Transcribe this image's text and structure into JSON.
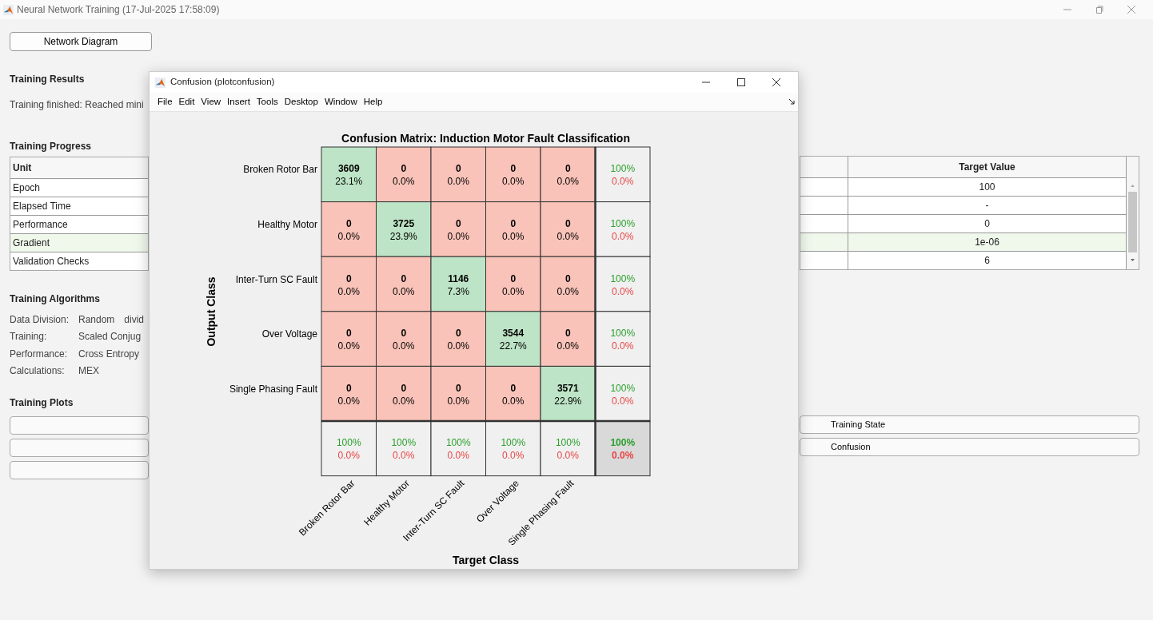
{
  "window": {
    "title": "Neural Network Training (17-Jul-2025 17:58:09)"
  },
  "network_diagram_button": {
    "label": "Network Diagram"
  },
  "training_results": {
    "heading": "Training Results",
    "message": "Training finished: Reached mini"
  },
  "training_progress": {
    "heading": "Training Progress",
    "columns": [
      "Unit",
      "Target Value"
    ],
    "rows": [
      {
        "unit": "Epoch",
        "target": "100",
        "highlighted": false
      },
      {
        "unit": "Elapsed Time",
        "target": "-",
        "highlighted": false
      },
      {
        "unit": "Performance",
        "target": "0",
        "highlighted": false
      },
      {
        "unit": "Gradient",
        "target": "1e-06",
        "highlighted": true
      },
      {
        "unit": "Validation Checks",
        "target": "6",
        "highlighted": false
      }
    ]
  },
  "training_algorithms": {
    "heading": "Training Algorithms",
    "items": [
      {
        "label": "Data Division:",
        "value": "Random",
        "extra": "divid"
      },
      {
        "label": "Training:",
        "value": "Scaled Conjug"
      },
      {
        "label": "Performance:",
        "value": "Cross Entropy"
      },
      {
        "label": "Calculations:",
        "value": "MEX"
      }
    ]
  },
  "training_plots": {
    "heading": "Training Plots",
    "buttons": [
      {
        "kind": "split",
        "label": "Training State"
      },
      {
        "kind": "split",
        "label": "Confusion"
      },
      {
        "kind": "left_only"
      }
    ]
  },
  "confusion_window": {
    "title": "Confusion (plotconfusion)",
    "menu": [
      "File",
      "Edit",
      "View",
      "Insert",
      "Tools",
      "Desktop",
      "Window",
      "Help"
    ],
    "plot": {
      "title": "Confusion Matrix: Induction Motor Fault Classification",
      "ylabel": "Output Class",
      "xlabel": "Target Class",
      "rows": [
        {
          "label": "Broken Rotor Bar",
          "cells": [
            {
              "kind": "correct",
              "count": "3609",
              "percent": "23.1%"
            },
            {
              "kind": "error",
              "count": "0",
              "percent": "0.0%"
            },
            {
              "kind": "error",
              "count": "0",
              "percent": "0.0%"
            },
            {
              "kind": "error",
              "count": "0",
              "percent": "0.0%"
            },
            {
              "kind": "error",
              "count": "0",
              "percent": "0.0%"
            }
          ],
          "summary": {
            "correct": "100%",
            "error": "0.0%"
          }
        },
        {
          "label": "Healthy Motor",
          "cells": [
            {
              "kind": "error",
              "count": "0",
              "percent": "0.0%"
            },
            {
              "kind": "correct",
              "count": "3725",
              "percent": "23.9%"
            },
            {
              "kind": "error",
              "count": "0",
              "percent": "0.0%"
            },
            {
              "kind": "error",
              "count": "0",
              "percent": "0.0%"
            },
            {
              "kind": "error",
              "count": "0",
              "percent": "0.0%"
            }
          ],
          "summary": {
            "correct": "100%",
            "error": "0.0%"
          }
        },
        {
          "label": "Inter-Turn SC Fault",
          "cells": [
            {
              "kind": "error",
              "count": "0",
              "percent": "0.0%"
            },
            {
              "kind": "error",
              "count": "0",
              "percent": "0.0%"
            },
            {
              "kind": "correct",
              "count": "1146",
              "percent": "7.3%"
            },
            {
              "kind": "error",
              "count": "0",
              "percent": "0.0%"
            },
            {
              "kind": "error",
              "count": "0",
              "percent": "0.0%"
            }
          ],
          "summary": {
            "correct": "100%",
            "error": "0.0%"
          }
        },
        {
          "label": "Over Voltage",
          "cells": [
            {
              "kind": "error",
              "count": "0",
              "percent": "0.0%"
            },
            {
              "kind": "error",
              "count": "0",
              "percent": "0.0%"
            },
            {
              "kind": "error",
              "count": "0",
              "percent": "0.0%"
            },
            {
              "kind": "correct",
              "count": "3544",
              "percent": "22.7%"
            },
            {
              "kind": "error",
              "count": "0",
              "percent": "0.0%"
            }
          ],
          "summary": {
            "correct": "100%",
            "error": "0.0%"
          }
        },
        {
          "label": "Single Phasing Fault",
          "cells": [
            {
              "kind": "error",
              "count": "0",
              "percent": "0.0%"
            },
            {
              "kind": "error",
              "count": "0",
              "percent": "0.0%"
            },
            {
              "kind": "error",
              "count": "0",
              "percent": "0.0%"
            },
            {
              "kind": "error",
              "count": "0",
              "percent": "0.0%"
            },
            {
              "kind": "correct",
              "count": "3571",
              "percent": "22.9%"
            }
          ],
          "summary": {
            "correct": "100%",
            "error": "0.0%"
          }
        }
      ],
      "column_summaries": [
        {
          "correct": "100%",
          "error": "0.0%"
        },
        {
          "correct": "100%",
          "error": "0.0%"
        },
        {
          "correct": "100%",
          "error": "0.0%"
        },
        {
          "correct": "100%",
          "error": "0.0%"
        },
        {
          "correct": "100%",
          "error": "0.0%"
        }
      ],
      "overall": {
        "correct": "100%",
        "error": "0.0%"
      },
      "column_labels": [
        "Broken Rotor Bar",
        "Healthy Motor",
        "Inter-Turn SC Fault",
        "Over Voltage",
        "Single Phasing Fault"
      ]
    }
  }
}
